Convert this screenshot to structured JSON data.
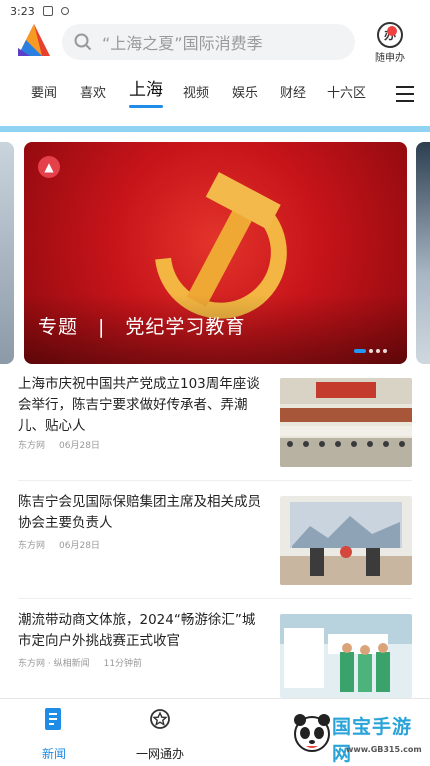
{
  "status_bar": {
    "time": "3:23"
  },
  "header": {
    "search_placeholder": "“上海之夏”国际消费季",
    "suishen_label": "随申办",
    "suishen_glyph": "办"
  },
  "tabs": [
    {
      "label": "要闻",
      "active": false
    },
    {
      "label": "喜欢",
      "active": false
    },
    {
      "label": "上海",
      "active": true
    },
    {
      "label": "视频",
      "active": false
    },
    {
      "label": "娱乐",
      "active": false
    },
    {
      "label": "财经",
      "active": false
    },
    {
      "label": "十六区",
      "active": false
    }
  ],
  "carousel": {
    "caption": "专题　|　党纪学习教育",
    "slide_count": 4,
    "active_index": 0
  },
  "news": [
    {
      "title": "上海市庆祝中国共产党成立103周年座谈会举行，陈吉宁要求做好传承者、弄潮儿、贴心人",
      "source": "东方网",
      "date": "06月28日",
      "extra": ""
    },
    {
      "title": "陈吉宁会见国际保赔集团主席及相关成员协会主要负责人",
      "source": "东方网",
      "date": "06月28日",
      "extra": ""
    },
    {
      "title": "潮流带动商文体旅，2024“畅游徐汇”城市定向户外挑战赛正式收官",
      "source": "东方网 · 纵相新闻",
      "date": "11分钟前",
      "extra": ""
    }
  ],
  "bottom_nav": [
    {
      "label": "新闻",
      "active": true
    },
    {
      "label": "一网通办",
      "active": false
    },
    {
      "label": "",
      "active": false
    }
  ],
  "watermark": {
    "text": "国宝手游网",
    "url": "www.GB315.com"
  },
  "colors": {
    "accent": "#1f8ce6",
    "banner_red": "#c7141a",
    "divider_blue": "#8fd2f2"
  }
}
